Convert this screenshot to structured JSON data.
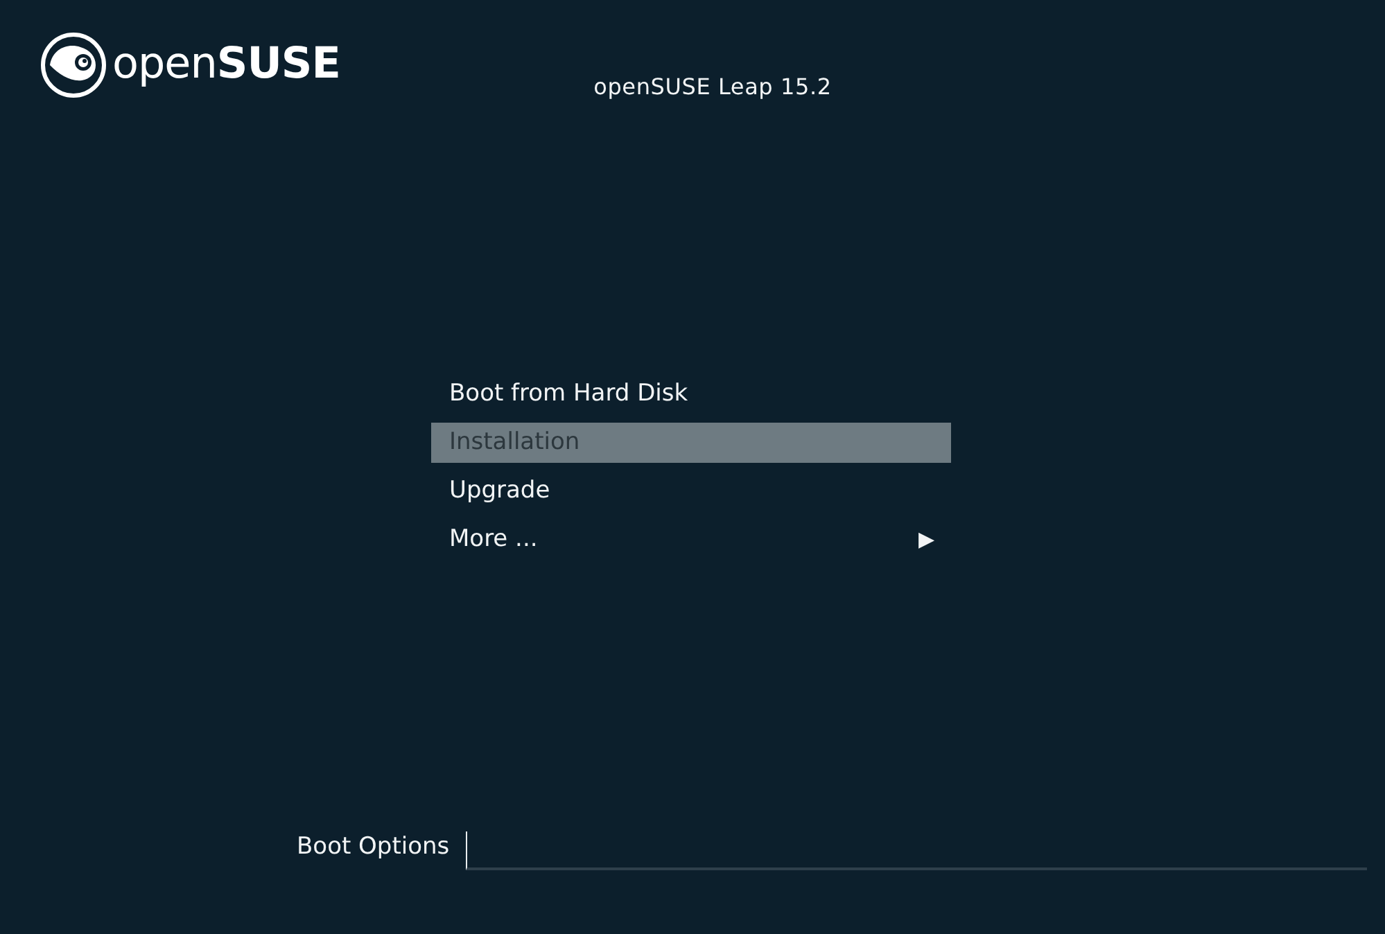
{
  "logo": {
    "text": "open**SUSE**"
  },
  "title": "openSUSE Leap 15.2",
  "menu": [
    {
      "label": "Boot from Hard Disk",
      "selected": false
    },
    {
      "label": "Installation",
      "selected": true
    },
    {
      "label": "Upgrade",
      "selected": false
    },
    {
      "label": "More ...",
      "selected": false,
      "arrow": "▶"
    }
  ],
  "boot_options": {
    "label": "Boot Options"
  }
}
